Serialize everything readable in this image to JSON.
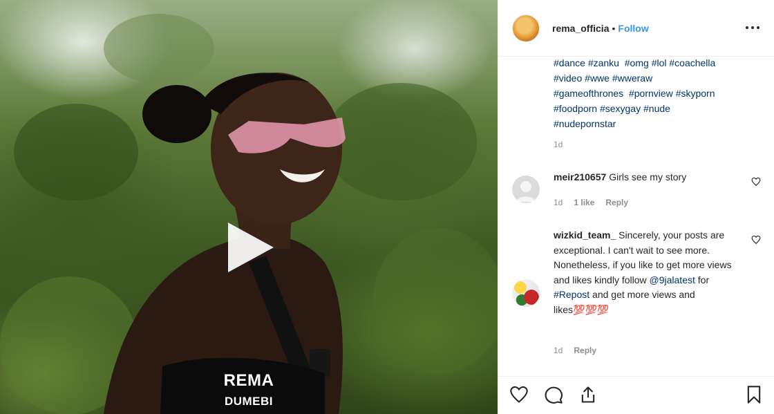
{
  "media": {
    "overlay_title": "REMA",
    "overlay_subtitle": "DUMEBI",
    "play_icon": "play-icon"
  },
  "header": {
    "username": "rema_officia",
    "separator": "•",
    "follow_label": "Follow",
    "more_icon": "more-horizontal-icon"
  },
  "caption": {
    "lines": [
      [
        "#dance",
        "#zanku",
        "#omg",
        "#lol",
        "#coachella"
      ],
      [
        "#video",
        "#wwe",
        "#wweraw"
      ],
      [
        "#gameofthrones",
        "#pornview",
        "#skyporn"
      ],
      [
        "#foodporn",
        "#sexygay",
        "#nude"
      ],
      [
        "#nudepornstar"
      ]
    ],
    "time": "1d"
  },
  "comments": [
    {
      "username": "meir210657",
      "text": "Girls see my story",
      "time": "1d",
      "likes": "1 like",
      "reply": "Reply"
    },
    {
      "username": "wizkid_team_",
      "text_before_mention": "Sincerely, your posts are exceptional. I can't wait to see more. Nonetheless, if you like to get more views and likes kindly follow",
      "mention": "@9jalatest",
      "text_after_mention": "for",
      "hashtag": "#Repost",
      "text_end": "and get more views and likes",
      "emoji": "💯💯💯",
      "time": "1d",
      "reply": "Reply"
    }
  ],
  "actions": {
    "like_icon": "heart-icon",
    "comment_icon": "comment-icon",
    "share_icon": "share-icon",
    "save_icon": "bookmark-icon"
  },
  "colors": {
    "link": "#003569",
    "follow": "#3897f0",
    "muted": "#8e8e8e",
    "text": "#262626"
  }
}
